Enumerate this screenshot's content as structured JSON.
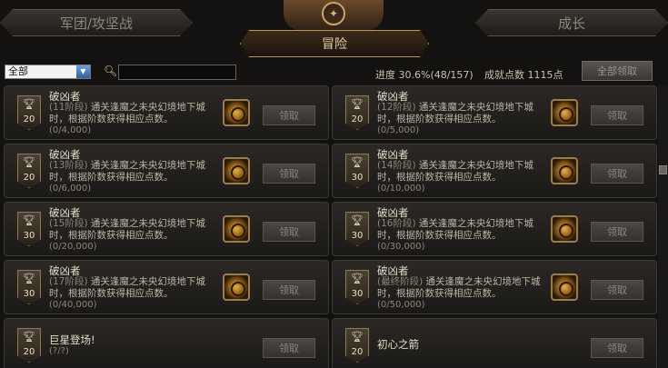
{
  "tabs": {
    "left": "军团/攻坚战",
    "right": "成长",
    "active": "冒险"
  },
  "filter": {
    "selected": "全部",
    "search_value": ""
  },
  "stats": {
    "progress": "进度  30.6%(48/157)",
    "points": "成就点数  1115点"
  },
  "buttons": {
    "claim_all": "全部领取"
  },
  "cards": [
    {
      "title": "破凶者",
      "tier": "(11阶段)",
      "desc": "通关逢魔之未央幻境地下城时，根据阶数获得相应点数。",
      "progress": "(0/4,000)",
      "badge": "20",
      "claim": "领取",
      "reward": true
    },
    {
      "title": "破凶者",
      "tier": "(12阶段)",
      "desc": "通关逢魔之未央幻境地下城时，根据阶数获得相应点数。",
      "progress": "(0/5,000)",
      "badge": "20",
      "claim": "领取",
      "reward": true
    },
    {
      "title": "破凶者",
      "tier": "(13阶段)",
      "desc": "通关逢魔之未央幻境地下城时，根据阶数获得相应点数。",
      "progress": "(0/6,000)",
      "badge": "20",
      "claim": "领取",
      "reward": true
    },
    {
      "title": "破凶者",
      "tier": "(14阶段)",
      "desc": "通关逢魔之未央幻境地下城时，根据阶数获得相应点数。",
      "progress": "(0/10,000)",
      "badge": "30",
      "claim": "领取",
      "reward": true
    },
    {
      "title": "破凶者",
      "tier": "(15阶段)",
      "desc": "通关逢魔之未央幻境地下城时，根据阶数获得相应点数。",
      "progress": "(0/20,000)",
      "badge": "30",
      "claim": "领取",
      "reward": true
    },
    {
      "title": "破凶者",
      "tier": "(16阶段)",
      "desc": "通关逢魔之未央幻境地下城时，根据阶数获得相应点数。",
      "progress": "(0/30,000)",
      "badge": "30",
      "claim": "领取",
      "reward": true
    },
    {
      "title": "破凶者",
      "tier": "(17阶段)",
      "desc": "通关逢魔之未央幻境地下城时，根据阶数获得相应点数。",
      "progress": "(0/40,000)",
      "badge": "30",
      "claim": "领取",
      "reward": true
    },
    {
      "title": "破凶者",
      "tier": "(最终阶段)",
      "desc": "通关逢魔之未央幻境地下城时，根据阶数获得相应点数。",
      "progress": "(0/50,000)",
      "badge": "30",
      "claim": "领取",
      "reward": true
    },
    {
      "title": "巨星登场!",
      "tier": "",
      "desc": "",
      "progress": "(?/?)",
      "badge": "20",
      "claim": "领取",
      "reward": false
    },
    {
      "title": "初心之箭",
      "tier": "",
      "desc": "",
      "progress": "",
      "badge": "20",
      "claim": "领取",
      "reward": false
    }
  ]
}
